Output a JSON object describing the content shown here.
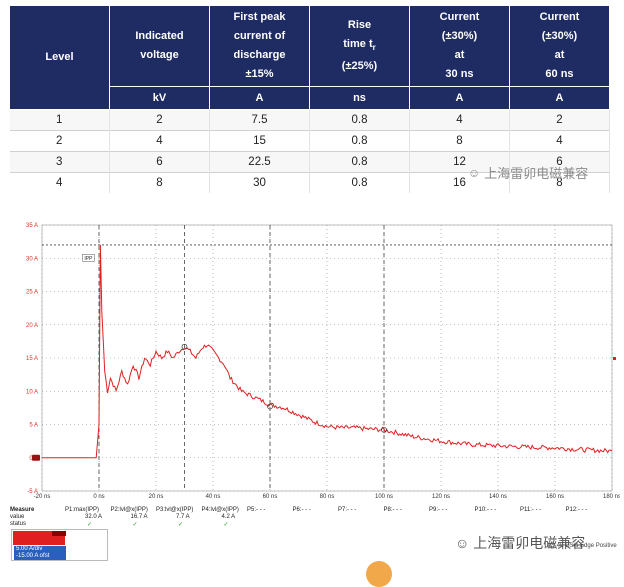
{
  "table": {
    "headers": [
      "Level",
      "Indicated voltage",
      "First peak current of discharge ±15%",
      "Rise time tr (±25%)",
      "Current (±30%) at 30 ns",
      "Current (±30%) at 60 ns"
    ],
    "header_lines": {
      "level": [
        "Level"
      ],
      "voltage": [
        "Indicated",
        "voltage"
      ],
      "peak": [
        "First peak",
        "current of",
        "discharge",
        "±15%"
      ],
      "rise": [
        "Rise",
        "time t",
        "r",
        "(±25%)"
      ],
      "c30": [
        "Current",
        "(±30%)",
        "at",
        "30 ns"
      ],
      "c60": [
        "Current",
        "(±30%)",
        "at",
        "60 ns"
      ]
    },
    "units": [
      "",
      "kV",
      "A",
      "ns",
      "A",
      "A"
    ],
    "rows": [
      [
        "1",
        "2",
        "7.5",
        "0.8",
        "4",
        "2"
      ],
      [
        "2",
        "4",
        "15",
        "0.8",
        "8",
        "4"
      ],
      [
        "3",
        "6",
        "22.5",
        "0.8",
        "12",
        "6"
      ],
      [
        "4",
        "8",
        "30",
        "0.8",
        "16",
        "8"
      ]
    ]
  },
  "watermark": {
    "text": "上海雷卯电磁兼容"
  },
  "scope": {
    "trace_color": "#e02020",
    "y_ticks": [
      "35 A",
      "30 A",
      "25 A",
      "20 A",
      "15 A",
      "10 A",
      "5 A",
      "0 A",
      "-5 A"
    ],
    "x_ticks": [
      "-20 ns",
      "0 ns",
      "20 ns",
      "40 ns",
      "60 ns",
      "80 ns",
      "100 ns",
      "120 ns",
      "140 ns",
      "160 ns",
      "180 ns"
    ],
    "marker_label": "IPP",
    "chart_data": {
      "type": "line",
      "x_unit": "ns",
      "y_unit": "A",
      "xlim": [
        -20,
        180
      ],
      "ylim": [
        -5,
        35
      ],
      "x": [
        -20,
        -1,
        0,
        0.5,
        1,
        2,
        3,
        4,
        6,
        8,
        10,
        12,
        14,
        16,
        18,
        20,
        22,
        24,
        26,
        28,
        30,
        32,
        34,
        36,
        38,
        40,
        42,
        44,
        46,
        48,
        50,
        55,
        60,
        65,
        70,
        75,
        80,
        85,
        90,
        95,
        100,
        110,
        120,
        130,
        140,
        150,
        160,
        170,
        180
      ],
      "y": [
        0,
        0,
        5,
        32,
        22,
        13,
        10,
        12,
        10,
        13,
        11,
        14,
        12,
        15,
        14,
        16,
        15,
        16,
        15,
        16,
        16.7,
        16,
        15,
        16.5,
        17,
        16,
        15,
        14,
        12,
        11,
        10,
        9,
        8,
        7.5,
        6.5,
        5.5,
        4.7,
        4.5,
        4.5,
        4.3,
        4.2,
        3.2,
        2.5,
        2.0,
        1.8,
        1.6,
        1.5,
        1.2,
        1.0
      ]
    }
  },
  "measure": {
    "title": "Measure",
    "value_label": "value",
    "status_label": "status",
    "columns": [
      {
        "name": "P1:max(IPP)",
        "value": "32.0 A"
      },
      {
        "name": "P2:lvl@x(IPP)",
        "value": "16.7 A"
      },
      {
        "name": "P3:lvl@x(IPP)",
        "value": "7.7 A"
      },
      {
        "name": "P4:lvl@x(IPP)",
        "value": "4.2 A"
      },
      {
        "name": "P5:- - -",
        "value": ""
      },
      {
        "name": "P6:- - -",
        "value": ""
      },
      {
        "name": "P7:- - -",
        "value": ""
      },
      {
        "name": "P8:- - -",
        "value": ""
      },
      {
        "name": "P9:- - -",
        "value": ""
      },
      {
        "name": "P10:- - -",
        "value": ""
      },
      {
        "name": "P11:- - -",
        "value": ""
      },
      {
        "name": "P12:- - -",
        "value": ""
      }
    ],
    "check": "✓",
    "channel_scale": "5.00 A/div",
    "channel_offset": "-15.00 A ofst",
    "right_bottom": "kS   40 GS/s Edge   Positive"
  }
}
